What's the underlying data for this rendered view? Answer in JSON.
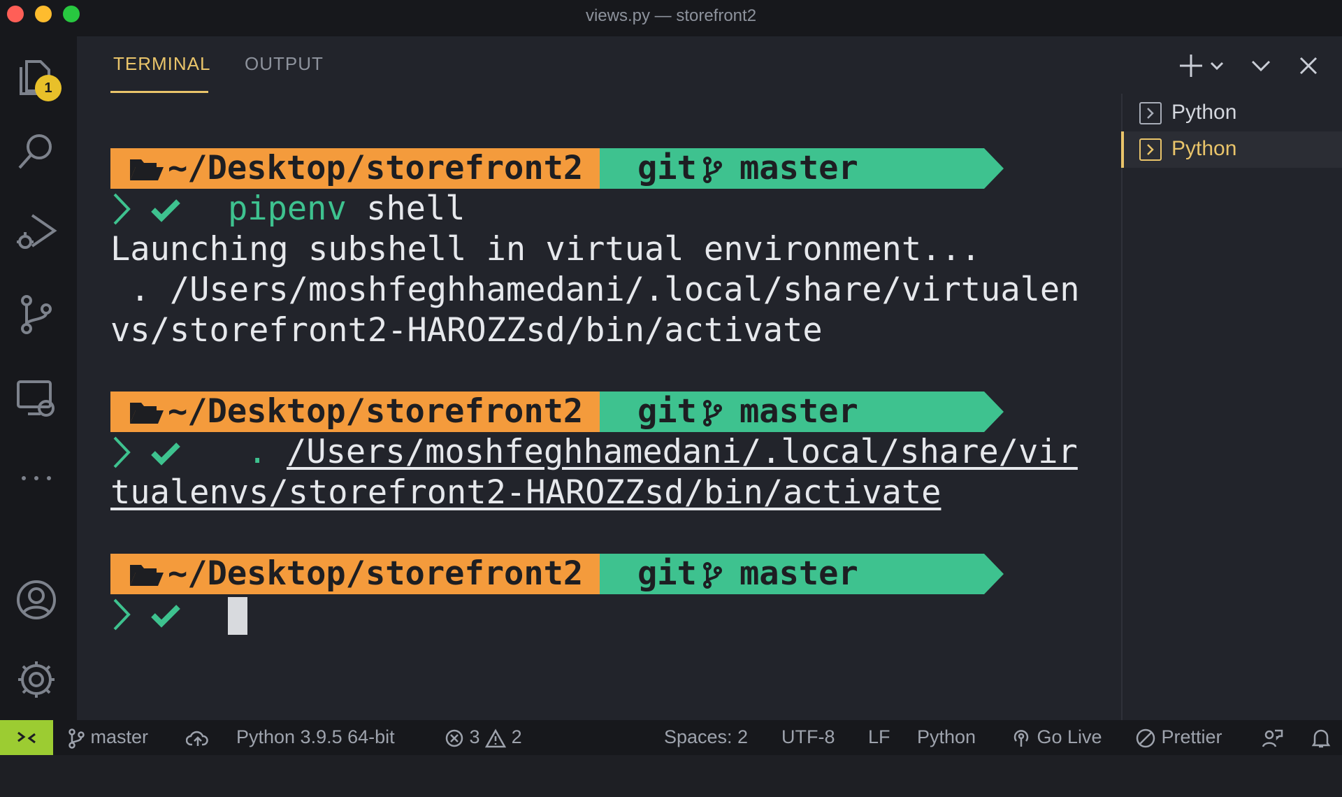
{
  "window": {
    "title": "views.py — storefront2"
  },
  "activity_bar": {
    "explorer_badge": "1"
  },
  "panel": {
    "tabs": [
      {
        "label": "TERMINAL",
        "active": true
      },
      {
        "label": "OUTPUT",
        "active": false
      }
    ],
    "terminals": [
      {
        "label": "Python",
        "active": false
      },
      {
        "label": "Python",
        "active": true
      }
    ]
  },
  "terminal": {
    "prompt_path": "~/Desktop/storefront2",
    "git_label": "git",
    "branch": "master",
    "command1_a": "pipenv",
    "command1_b": " shell",
    "output1": "Launching subshell in virtual environment...",
    "output2": " . /Users/moshfeghhamedani/.local/share/virtualen",
    "output3": "vs/storefront2-HAROZZsd/bin/activate",
    "command2_dot": ".",
    "command2_path_a": "/Users/moshfeghhamedani/.local/share/vir",
    "command2_path_b": "tualenvs/storefront2-HAROZZsd/bin/activate"
  },
  "statusbar": {
    "branch": "master",
    "python": "Python 3.9.5 64-bit",
    "errors": "3",
    "warnings": "2",
    "spaces": "Spaces: 2",
    "encoding": "UTF-8",
    "eol": "LF",
    "language": "Python",
    "golive": "Go Live",
    "prettier": "Prettier"
  },
  "colors": {
    "accent": "#e9c46a",
    "prompt_path_bg": "#f49b3c",
    "prompt_git_bg": "#3ec28f",
    "remote_bg": "#9ccc32"
  }
}
